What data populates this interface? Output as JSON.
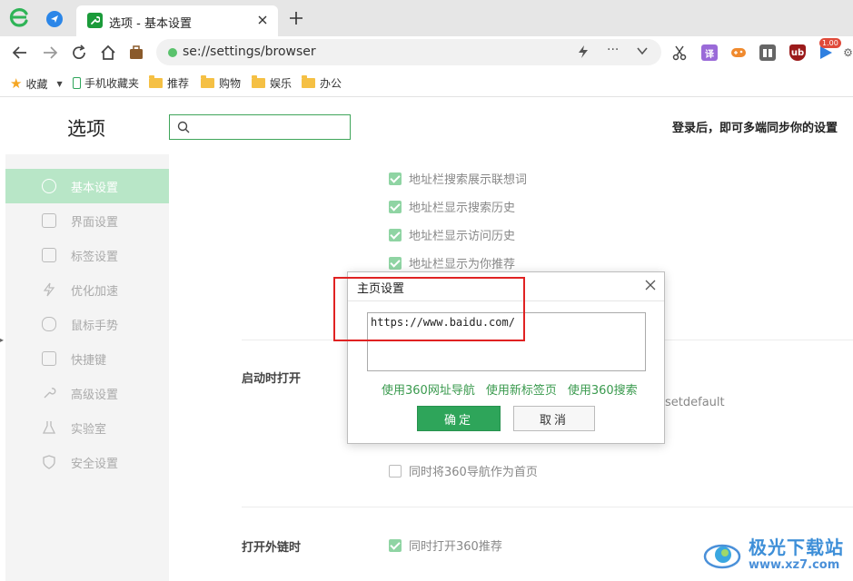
{
  "tab": {
    "title": "选项 - 基本设置"
  },
  "address_bar": {
    "url": "se://settings/browser"
  },
  "extensions": {
    "badge": "1.00"
  },
  "bookmarks": [
    {
      "label": "收藏",
      "kind": "star"
    },
    {
      "label": "手机收藏夹",
      "kind": "phone"
    },
    {
      "label": "推荐",
      "kind": "folder"
    },
    {
      "label": "购物",
      "kind": "folder"
    },
    {
      "label": "娱乐",
      "kind": "folder"
    },
    {
      "label": "办公",
      "kind": "folder"
    }
  ],
  "settings": {
    "title": "选项",
    "search_placeholder": "",
    "login_hint": "登录后，即可多端同步你的设置",
    "sidebar": [
      {
        "label": "基本设置",
        "active": true
      },
      {
        "label": "界面设置"
      },
      {
        "label": "标签设置"
      },
      {
        "label": "优化加速"
      },
      {
        "label": "鼠标手势"
      },
      {
        "label": "快捷键"
      },
      {
        "label": "高级设置"
      },
      {
        "label": "实验室"
      },
      {
        "label": "安全设置"
      }
    ],
    "address_options": [
      {
        "label": "地址栏搜索展示联想词",
        "checked": true
      },
      {
        "label": "地址栏显示搜索历史",
        "checked": true
      },
      {
        "label": "地址栏显示访问历史",
        "checked": true
      },
      {
        "label": "地址栏显示为你推荐",
        "checked": true
      }
    ],
    "startup": {
      "label": "启动时打开",
      "partial_text": "setdefault",
      "homepage_option": {
        "label": "同时将360导航作为首页",
        "checked": false
      }
    },
    "external_links": {
      "label": "打开外链时",
      "option": {
        "label": "同时打开360推荐",
        "checked": true
      }
    }
  },
  "dialog": {
    "title": "主页设置",
    "url_value": "https://www.baidu.com/",
    "links": [
      "使用360网址导航",
      "使用新标签页",
      "使用360搜索"
    ],
    "ok_label": "确定",
    "cancel_label": "取消"
  },
  "watermark": {
    "name": "极光下载站",
    "url": "www.xz7.com"
  },
  "colors": {
    "accent": "#2ea55a",
    "highlight": "#e02222",
    "sidebar_active": "#b8e6c7"
  }
}
